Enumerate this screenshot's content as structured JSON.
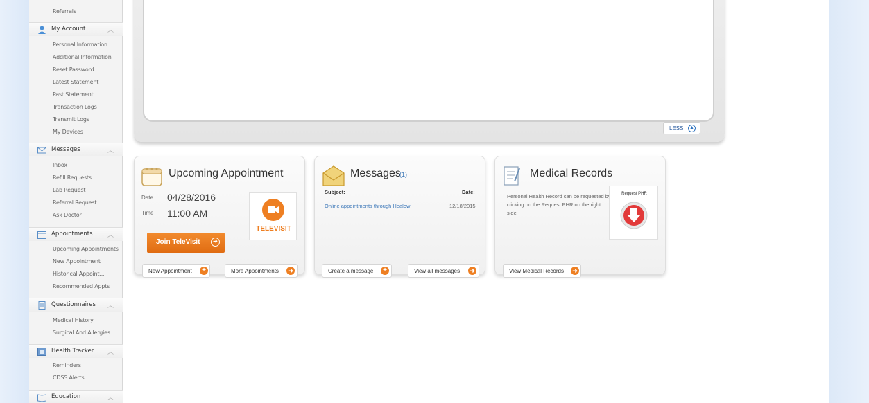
{
  "sidebar": {
    "top_item": "Referrals",
    "sections": [
      {
        "label": "My Account",
        "items": [
          "Personal Information",
          "Additional Information",
          "Reset Password",
          "Latest Statement",
          "Past Statement",
          "Transaction Logs",
          "Transmit Logs",
          "My Devices"
        ]
      },
      {
        "label": "Messages",
        "items": [
          "Inbox",
          "Refill Requests",
          "Lab Request",
          "Referral Request",
          "Ask Doctor"
        ]
      },
      {
        "label": "Appointments",
        "items": [
          "Upcoming Appointments",
          "New Appointment",
          "Historical Appoint...",
          "Recommended Appts"
        ]
      },
      {
        "label": "Questionnaires",
        "items": [
          "Medical History",
          "Surgical And Allergies"
        ]
      },
      {
        "label": "Health Tracker",
        "items": [
          "Reminders",
          "CDSS Alerts"
        ]
      },
      {
        "label": "Education",
        "items": []
      }
    ]
  },
  "frame": {
    "less_label": "LESS"
  },
  "appointment": {
    "title": "Upcoming Appointment",
    "date_label": "Date",
    "date": "04/28/2016",
    "time_label": "Time",
    "time": "11:00 AM",
    "televisit_label": "TELEVISIT",
    "join_label": "Join TeleVisit",
    "new_label": "New Appointment",
    "more_label": "More Appointments"
  },
  "messages": {
    "title": "Messages",
    "count": "(1)",
    "subject_header": "Subject:",
    "date_header": "Date:",
    "rows": [
      {
        "subject": "Online appointments through Healow",
        "date": "12/18/2015"
      }
    ],
    "create_label": "Create a message",
    "view_label": "View all messages"
  },
  "records": {
    "title": "Medical Records",
    "description": "Personal Health Record can be requested by clicking on the Request PHR on the right side",
    "request_label": "Request PHR",
    "view_label": "View Medical Records"
  },
  "colors": {
    "accent": "#ee7f22",
    "link": "#3d78b8"
  }
}
